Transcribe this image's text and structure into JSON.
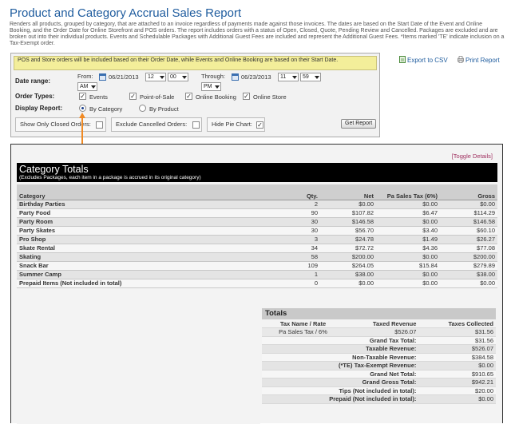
{
  "page": {
    "title": "Product and Category Accrual Sales Report",
    "description": "Renders all products, grouped by category, that are attached to an invoice regardless of payments made against those invoices. The dates are based on the Start Date of the Event and Online Booking, and the Order Date for Online Storefront and POS orders. The report includes orders with a status of Open, Closed, Quote, Pending Review and Cancelled. Packages are excluded and are broken out into their individual products. Events and Schedulable Packages with Additional Guest Fees are included and represent the Additional Guest Fees. *Items marked 'TE' indicate inclusion on a Tax-Exempt order."
  },
  "filters": {
    "notice": "POS and Store orders will be included based on their Order Date, while Events and Online Booking are based on their Start Date.",
    "date_range_label": "Date range:",
    "from_label": "From:",
    "from_date": "06/21/2013",
    "from_hour": "12",
    "from_min": "00",
    "from_ampm": "AM",
    "through_label": "Through:",
    "through_date": "06/23/2013",
    "through_hour": "11",
    "through_min": "59",
    "through_ampm": "PM",
    "order_types_label": "Order Types:",
    "order_types": [
      "Events",
      "Point-of-Sale",
      "Online Booking",
      "Online Store"
    ],
    "display_report_label": "Display Report:",
    "display_options": [
      "By Category",
      "By Product"
    ],
    "display_selected": "By Category",
    "show_closed_label": "Show Only Closed Orders:",
    "exclude_cancelled_label": "Exclude Cancelled Orders:",
    "hide_pie_label": "Hide Pie Chart:",
    "hide_pie_checked": true,
    "get_report_label": "Get Report",
    "check_mark": "✓"
  },
  "actions": {
    "export_csv": "Export to CSV",
    "print_report": "Print Report"
  },
  "results": {
    "toggle_details": "[Toggle Details]",
    "section_title": "Category Totals",
    "section_subtitle": "(Excludes Packages, each item in a package is accrued in its original category)",
    "columns": [
      "Category",
      "Qty.",
      "Net",
      "Pa Sales Tax (6%)",
      "Gross"
    ],
    "rows": [
      [
        "Birthday Parties",
        "2",
        "$0.00",
        "$0.00",
        "$0.00"
      ],
      [
        "Party Food",
        "90",
        "$107.82",
        "$6.47",
        "$114.29"
      ],
      [
        "Party Room",
        "30",
        "$146.58",
        "$0.00",
        "$146.58"
      ],
      [
        "Party Skates",
        "30",
        "$56.70",
        "$3.40",
        "$60.10"
      ],
      [
        "Pro Shop",
        "3",
        "$24.78",
        "$1.49",
        "$26.27"
      ],
      [
        "Skate Rental",
        "34",
        "$72.72",
        "$4.36",
        "$77.08"
      ],
      [
        "Skating",
        "58",
        "$200.00",
        "$0.00",
        "$200.00"
      ],
      [
        "Snack Bar",
        "109",
        "$264.05",
        "$15.84",
        "$279.89"
      ],
      [
        "Summer Camp",
        "1",
        "$38.00",
        "$0.00",
        "$38.00"
      ],
      [
        "Prepaid Items (Not included in total)",
        "0",
        "$0.00",
        "$0.00",
        "$0.00"
      ]
    ],
    "totals_title": "Totals",
    "totals_header": [
      "Tax Name / Rate",
      "Taxed Revenue",
      "Taxes Collected"
    ],
    "tax_row": [
      "Pa Sales Tax / 6%",
      "$526.07",
      "$31.56"
    ],
    "summary": [
      [
        "Grand Tax Total:",
        "$31.56"
      ],
      [
        "Taxable Revenue:",
        "$526.07"
      ],
      [
        "Non-Taxable Revenue:",
        "$384.58"
      ],
      [
        "(*TE) Tax-Exempt Revenue:",
        "$0.00"
      ],
      [
        "Grand Net Total:",
        "$910.65"
      ],
      [
        "Grand Gross Total:",
        "$942.21"
      ],
      [
        "Tips (Not included in total):",
        "$20.00"
      ],
      [
        "Prepaid (Not included in total):",
        "$0.00"
      ]
    ]
  }
}
